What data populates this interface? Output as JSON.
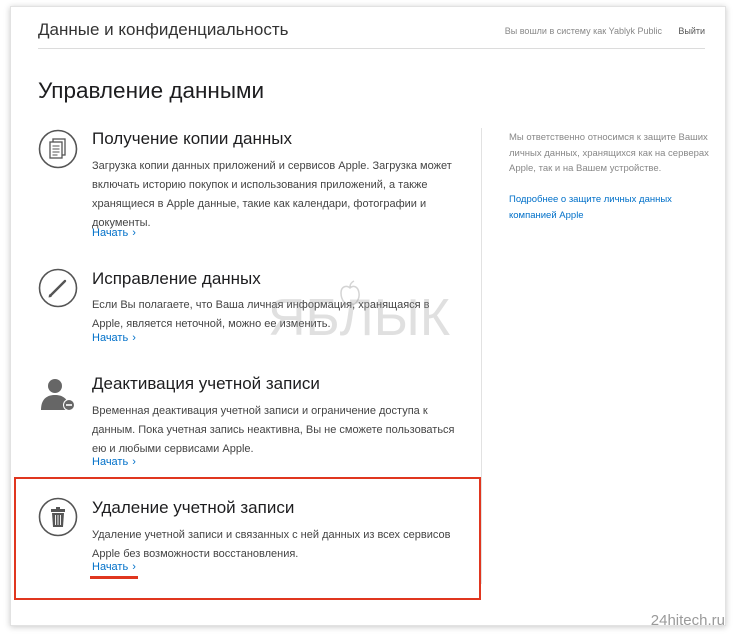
{
  "header": {
    "title": "Данные и конфиденциальность",
    "user_text": "Вы вошли в систему как Yablyk Public",
    "logout_label": "Выйти"
  },
  "page_title": "Управление данными",
  "sections": [
    {
      "icon": "documents-icon",
      "title": "Получение копии данных",
      "description": "Загрузка копии данных приложений и сервисов Apple. Загрузка может включать историю покупок и использования приложений, а также хранящиеся в Apple данные, такие как календари, фотографии и документы.",
      "link_label": "Начать"
    },
    {
      "icon": "pencil-icon",
      "title": "Исправление данных",
      "description": "Если Вы полагаете, что Ваша личная информация, хранящаяся в Apple, является неточной, можно ее изменить.",
      "link_label": "Начать"
    },
    {
      "icon": "user-remove-icon",
      "title": "Деактивация учетной записи",
      "description": "Временная деактивация учетной записи и ограничение доступа к данным. Пока учетная запись неактивна, Вы не сможете пользоваться ею и любыми сервисами Apple.",
      "link_label": "Начать"
    },
    {
      "icon": "trash-icon",
      "title": "Удаление учетной записи",
      "description": "Удаление учетной записи и связанных с ней данных из всех сервисов Apple без возможности восстановления.",
      "link_label": "Начать"
    }
  ],
  "sidebar": {
    "text": "Мы ответственно относимся к защите Ваших личных данных, хранящихся как на серверах Apple, так и на Вашем устройстве.",
    "link_label": "Подробнее о защите личных данных компанией Apple"
  },
  "watermark": "ЯБЛЫК",
  "site_mark": "24hitech.ru",
  "colors": {
    "link": "#0070c9",
    "highlight": "#e0361f",
    "text": "#1d1d1f"
  }
}
